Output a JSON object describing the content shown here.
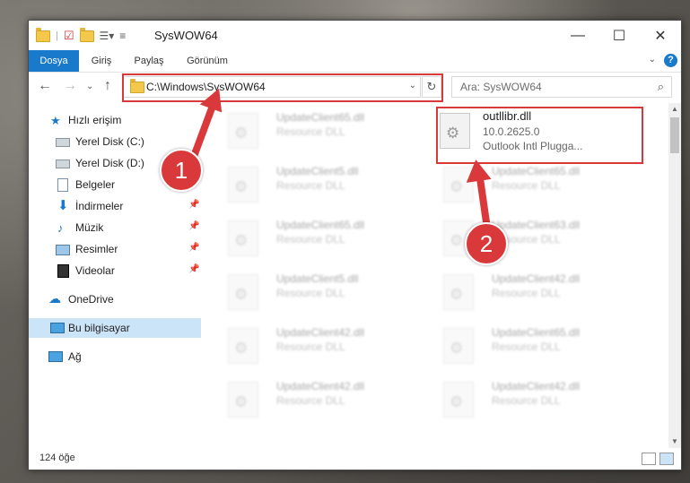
{
  "window": {
    "title": "SysWOW64",
    "minimize_glyph": "—",
    "maximize_glyph": "☐",
    "close_glyph": "✕"
  },
  "ribbon": {
    "tabs": [
      "Dosya",
      "Giriş",
      "Paylaş",
      "Görünüm"
    ],
    "help_glyph": "?",
    "expand_glyph": "⌄"
  },
  "nav": {
    "back_glyph": "←",
    "forward_glyph": "→",
    "recent_glyph": "⌄",
    "up_glyph": "↑",
    "address": "C:\\Windows\\SysWOW64",
    "address_dropdown_glyph": "⌄",
    "refresh_glyph": "↻",
    "search_placeholder": "Ara: SysWOW64",
    "search_icon": "⌕"
  },
  "sidebar": {
    "items": [
      {
        "label": "Hızlı erişim",
        "icon": "star-icon",
        "pinned": false
      },
      {
        "label": "Yerel Disk (C:)",
        "icon": "drive-icon",
        "pinned": false
      },
      {
        "label": "Yerel Disk (D:)",
        "icon": "drive-icon",
        "pinned": false
      },
      {
        "label": "Belgeler",
        "icon": "documents-icon",
        "pinned": true
      },
      {
        "label": "İndirmeler",
        "icon": "download-icon",
        "pinned": true
      },
      {
        "label": "Müzik",
        "icon": "music-icon",
        "pinned": true
      },
      {
        "label": "Resimler",
        "icon": "pictures-icon",
        "pinned": true
      },
      {
        "label": "Videolar",
        "icon": "video-icon",
        "pinned": true
      },
      {
        "label": "OneDrive",
        "icon": "cloud-icon",
        "pinned": false
      },
      {
        "label": "Bu bilgisayar",
        "icon": "computer-icon",
        "pinned": false,
        "selected": true
      },
      {
        "label": "Ağ",
        "icon": "network-icon",
        "pinned": false
      }
    ],
    "pin_glyph": "📌"
  },
  "files": {
    "highlighted": {
      "name": "outllibr.dll",
      "version": "10.0.2625.0",
      "description": "Outlook Intl Plugga..."
    },
    "left_column": [
      {
        "name": "UpdateClient65.dll",
        "type": "Resource DLL"
      },
      {
        "name": "UpdateClient5.dll",
        "type": "Resource DLL"
      },
      {
        "name": "UpdateClient65.dll",
        "type": "Resource DLL"
      },
      {
        "name": "UpdateClient5.dll",
        "type": "Resource DLL"
      },
      {
        "name": "UpdateClient42.dll",
        "type": "Resource DLL"
      },
      {
        "name": "UpdateClient42.dll",
        "type": "Resource DLL"
      }
    ],
    "right_column": [
      {
        "name": "UpdateClient65.dll",
        "type": "Resource DLL"
      },
      {
        "name": "UpdateClient63.dll",
        "type": "Resource DLL"
      },
      {
        "name": "UpdateClient42.dll",
        "type": "Resource DLL"
      },
      {
        "name": "UpdateClient65.dll",
        "type": "Resource DLL"
      },
      {
        "name": "UpdateClient42.dll",
        "type": "Resource DLL"
      }
    ]
  },
  "status": {
    "item_count": "124 öğe"
  },
  "annotations": {
    "badge1": "1",
    "badge2": "2",
    "accent": "#d9393a"
  }
}
